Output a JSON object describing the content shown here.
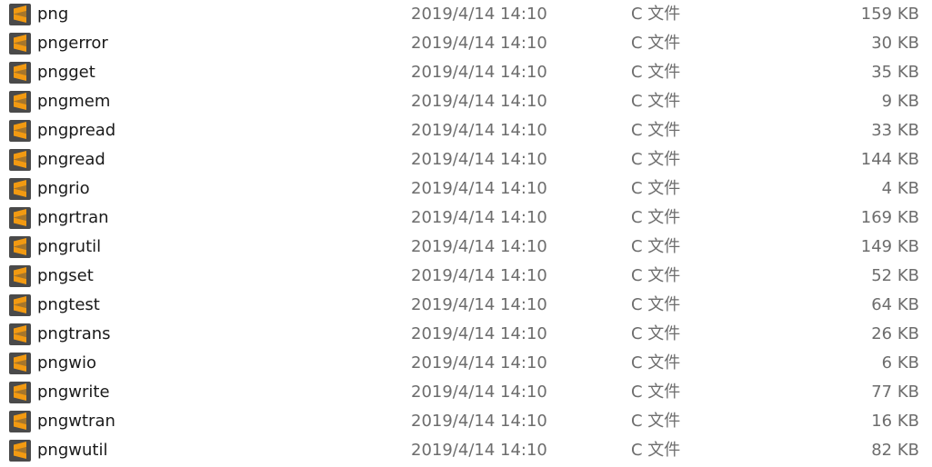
{
  "icon_name": "sublime-text-icon",
  "colors": {
    "icon_bg": "#4a4a4a",
    "icon_accent": "#f29a12",
    "name_text": "#1a1a1a",
    "meta_text": "#6d6d6d"
  },
  "files": [
    {
      "name": "png",
      "date": "2019/4/14 14:10",
      "type": "C 文件",
      "size": "159 KB"
    },
    {
      "name": "pngerror",
      "date": "2019/4/14 14:10",
      "type": "C 文件",
      "size": "30 KB"
    },
    {
      "name": "pngget",
      "date": "2019/4/14 14:10",
      "type": "C 文件",
      "size": "35 KB"
    },
    {
      "name": "pngmem",
      "date": "2019/4/14 14:10",
      "type": "C 文件",
      "size": "9 KB"
    },
    {
      "name": "pngpread",
      "date": "2019/4/14 14:10",
      "type": "C 文件",
      "size": "33 KB"
    },
    {
      "name": "pngread",
      "date": "2019/4/14 14:10",
      "type": "C 文件",
      "size": "144 KB"
    },
    {
      "name": "pngrio",
      "date": "2019/4/14 14:10",
      "type": "C 文件",
      "size": "4 KB"
    },
    {
      "name": "pngrtran",
      "date": "2019/4/14 14:10",
      "type": "C 文件",
      "size": "169 KB"
    },
    {
      "name": "pngrutil",
      "date": "2019/4/14 14:10",
      "type": "C 文件",
      "size": "149 KB"
    },
    {
      "name": "pngset",
      "date": "2019/4/14 14:10",
      "type": "C 文件",
      "size": "52 KB"
    },
    {
      "name": "pngtest",
      "date": "2019/4/14 14:10",
      "type": "C 文件",
      "size": "64 KB"
    },
    {
      "name": "pngtrans",
      "date": "2019/4/14 14:10",
      "type": "C 文件",
      "size": "26 KB"
    },
    {
      "name": "pngwio",
      "date": "2019/4/14 14:10",
      "type": "C 文件",
      "size": "6 KB"
    },
    {
      "name": "pngwrite",
      "date": "2019/4/14 14:10",
      "type": "C 文件",
      "size": "77 KB"
    },
    {
      "name": "pngwtran",
      "date": "2019/4/14 14:10",
      "type": "C 文件",
      "size": "16 KB"
    },
    {
      "name": "pngwutil",
      "date": "2019/4/14 14:10",
      "type": "C 文件",
      "size": "82 KB"
    }
  ]
}
